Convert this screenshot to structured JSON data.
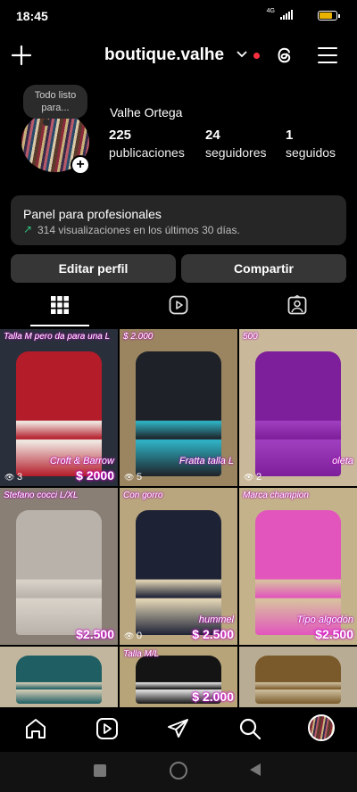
{
  "status_bar": {
    "time": "18:45",
    "network": "4G",
    "battery_level": 0.7,
    "battery_color": "#e9b200"
  },
  "header": {
    "username": "boutique.valhe",
    "notification_dot_color": "#ff3040"
  },
  "profile": {
    "note": "Todo listo para...",
    "full_name": "Valhe Ortega",
    "stats": [
      {
        "value": "225",
        "label": "publicaciones"
      },
      {
        "value": "24",
        "label": "seguidores"
      },
      {
        "value": "1",
        "label": "seguidos"
      }
    ]
  },
  "pro_panel": {
    "title": "Panel para profesionales",
    "subtitle": "314 visualizaciones en los últimos 30 días."
  },
  "actions": {
    "edit": "Editar perfil",
    "share": "Compartir"
  },
  "tabs": [
    {
      "icon": "grid-icon",
      "active": true
    },
    {
      "icon": "reels-icon",
      "active": false
    },
    {
      "icon": "tagged-icon",
      "active": false
    }
  ],
  "posts": [
    {
      "label": "Talla M pero da para una L",
      "side_label": "Croft & Barrow",
      "price": "$ 2000",
      "views": "3",
      "colors": [
        "#2a2f3c",
        "#b41c2a",
        "#f2efe9"
      ]
    },
    {
      "label": "$ 2.000",
      "side_label": "Fratta talla L",
      "price": "",
      "views": "5",
      "colors": [
        "#9a8560",
        "#1e2228",
        "#2fb5c8"
      ]
    },
    {
      "label": "500",
      "side_label": "oleta",
      "price": "",
      "views": "2",
      "colors": [
        "#c9b99a",
        "#7d1e9a",
        "#a040c0"
      ]
    },
    {
      "label": "Stefano cocci L/XL",
      "side_label": "",
      "price": "$2.500",
      "views": "",
      "colors": [
        "#8a7f74",
        "#b9b2aa",
        "#d9d3ca"
      ]
    },
    {
      "label": "Con gorro",
      "side_label": "hummel",
      "price": "$ 2.500",
      "views": "0",
      "colors": [
        "#b9a67e",
        "#1d2235",
        "#e6d9b8"
      ]
    },
    {
      "label": "Marca champion",
      "side_label": "Tipo algodón",
      "price": "$2.500",
      "views": "",
      "colors": [
        "#c4b28a",
        "#e255bd",
        "#d8c49e"
      ]
    },
    {
      "label": "",
      "side_label": "",
      "price": "",
      "views": "",
      "colors": [
        "#c2b79e",
        "#1f5e63",
        "#d8cfb8"
      ]
    },
    {
      "label": "Talla M/L",
      "side_label": "",
      "price": "$ 2.000",
      "views": "",
      "colors": [
        "#b8a479",
        "#141414",
        "#e8e8e8"
      ]
    },
    {
      "label": "",
      "side_label": "",
      "price": "",
      "views": "",
      "colors": [
        "#b8ad94",
        "#7a5a2a",
        "#cfc1a0"
      ]
    }
  ],
  "bottom_nav": [
    "home-icon",
    "reels-icon",
    "send-icon",
    "search-icon",
    "profile-avatar"
  ]
}
